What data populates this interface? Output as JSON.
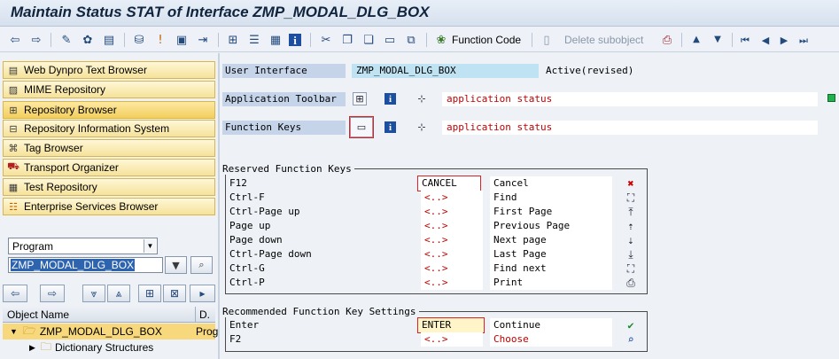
{
  "window": {
    "title": "Maintain Status STAT of Interface ZMP_MODAL_DLG_BOX"
  },
  "toolbar": {
    "function_code_label": "Function Code",
    "delete_subobject_label": "Delete subobject",
    "icons": [
      "back-arrow-icon",
      "forward-arrow-icon",
      "pencil-icon",
      "activate-icon",
      "object-list-icon",
      "where-used-icon",
      "usage-icon",
      "display-icon",
      "navigate-icon",
      "hierarchy-icon",
      "stack-icon",
      "table-icon",
      "info-icon",
      "cut-icon",
      "copy-icon",
      "paste-icon",
      "insert-icon",
      "undo-icon",
      "function-code-icon",
      "delete-icon",
      "printer-icon",
      "move-up-icon",
      "move-down-icon",
      "first-page-icon",
      "previous-icon",
      "next-icon",
      "last-page-icon"
    ]
  },
  "nav": {
    "items": [
      {
        "label": "Web Dynpro Text Browser",
        "icon": "list-icon"
      },
      {
        "label": "MIME Repository",
        "icon": "mime-icon"
      },
      {
        "label": "Repository Browser",
        "icon": "repository-icon",
        "active": true
      },
      {
        "label": "Repository Information System",
        "icon": "info-system-icon"
      },
      {
        "label": "Tag Browser",
        "icon": "tag-icon"
      },
      {
        "label": "Transport Organizer",
        "icon": "truck-icon"
      },
      {
        "label": "Test Repository",
        "icon": "test-icon"
      },
      {
        "label": "Enterprise Services Browser",
        "icon": "services-icon"
      }
    ],
    "object_type": "Program",
    "object_name": "ZMP_MODAL_DLG_BOX"
  },
  "tree": {
    "header": {
      "name": "Object Name",
      "desc": "D."
    },
    "rows": [
      {
        "label": "ZMP_MODAL_DLG_BOX",
        "extra": "Prog",
        "expanded": true
      },
      {
        "label": "Dictionary Structures",
        "extra": ""
      }
    ]
  },
  "interface": {
    "user_interface_label": "User Interface",
    "user_interface_value": "ZMP_MODAL_DLG_BOX",
    "status": "Active(revised)",
    "app_toolbar_label": "Application Toolbar",
    "app_toolbar_value": "application status",
    "function_keys_label": "Function Keys",
    "function_keys_value": "application status"
  },
  "reserved_keys": {
    "title": "Reserved Function Keys",
    "rows": [
      {
        "key": "F12",
        "code": "CANCEL",
        "text": "Cancel",
        "icon": "cancel-icon"
      },
      {
        "key": "Ctrl-F",
        "code": "<..>",
        "text": "Find",
        "icon": "find-icon"
      },
      {
        "key": "Ctrl-Page up",
        "code": "<..>",
        "text": "First Page",
        "icon": "first-page-icon"
      },
      {
        "key": "Page up",
        "code": "<..>",
        "text": "Previous Page",
        "icon": "previous-page-icon"
      },
      {
        "key": "Page down",
        "code": "<..>",
        "text": "Next page",
        "icon": "next-page-icon"
      },
      {
        "key": "Ctrl-Page down",
        "code": "<..>",
        "text": "Last Page",
        "icon": "last-page-icon"
      },
      {
        "key": "Ctrl-G",
        "code": "<..>",
        "text": "Find next",
        "icon": "find-next-icon"
      },
      {
        "key": "Ctrl-P",
        "code": "<..>",
        "text": "Print",
        "icon": "print-icon"
      }
    ]
  },
  "recommended_keys": {
    "title": "Recommended Function Key Settings",
    "rows": [
      {
        "key": "Enter",
        "code": "ENTER",
        "text": "Continue",
        "icon": "checkmark-icon"
      },
      {
        "key": "F2",
        "code": "<..>",
        "text": "Choose",
        "icon": "choose-icon"
      }
    ]
  }
}
